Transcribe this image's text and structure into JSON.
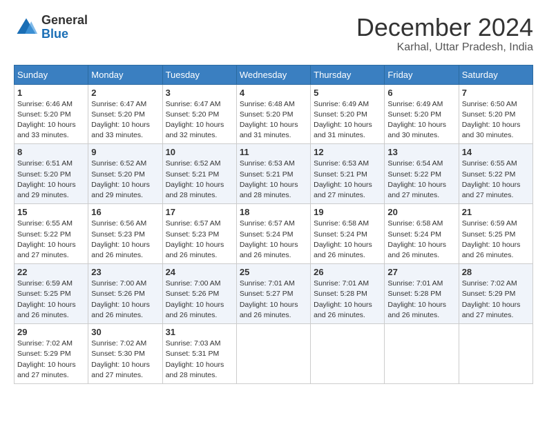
{
  "header": {
    "logo_line1": "General",
    "logo_line2": "Blue",
    "month": "December 2024",
    "location": "Karhal, Uttar Pradesh, India"
  },
  "weekdays": [
    "Sunday",
    "Monday",
    "Tuesday",
    "Wednesday",
    "Thursday",
    "Friday",
    "Saturday"
  ],
  "weeks": [
    [
      {
        "day": "1",
        "sunrise": "6:46 AM",
        "sunset": "5:20 PM",
        "daylight": "10 hours and 33 minutes."
      },
      {
        "day": "2",
        "sunrise": "6:47 AM",
        "sunset": "5:20 PM",
        "daylight": "10 hours and 33 minutes."
      },
      {
        "day": "3",
        "sunrise": "6:47 AM",
        "sunset": "5:20 PM",
        "daylight": "10 hours and 32 minutes."
      },
      {
        "day": "4",
        "sunrise": "6:48 AM",
        "sunset": "5:20 PM",
        "daylight": "10 hours and 31 minutes."
      },
      {
        "day": "5",
        "sunrise": "6:49 AM",
        "sunset": "5:20 PM",
        "daylight": "10 hours and 31 minutes."
      },
      {
        "day": "6",
        "sunrise": "6:49 AM",
        "sunset": "5:20 PM",
        "daylight": "10 hours and 30 minutes."
      },
      {
        "day": "7",
        "sunrise": "6:50 AM",
        "sunset": "5:20 PM",
        "daylight": "10 hours and 30 minutes."
      }
    ],
    [
      {
        "day": "8",
        "sunrise": "6:51 AM",
        "sunset": "5:20 PM",
        "daylight": "10 hours and 29 minutes."
      },
      {
        "day": "9",
        "sunrise": "6:52 AM",
        "sunset": "5:20 PM",
        "daylight": "10 hours and 29 minutes."
      },
      {
        "day": "10",
        "sunrise": "6:52 AM",
        "sunset": "5:21 PM",
        "daylight": "10 hours and 28 minutes."
      },
      {
        "day": "11",
        "sunrise": "6:53 AM",
        "sunset": "5:21 PM",
        "daylight": "10 hours and 28 minutes."
      },
      {
        "day": "12",
        "sunrise": "6:53 AM",
        "sunset": "5:21 PM",
        "daylight": "10 hours and 27 minutes."
      },
      {
        "day": "13",
        "sunrise": "6:54 AM",
        "sunset": "5:22 PM",
        "daylight": "10 hours and 27 minutes."
      },
      {
        "day": "14",
        "sunrise": "6:55 AM",
        "sunset": "5:22 PM",
        "daylight": "10 hours and 27 minutes."
      }
    ],
    [
      {
        "day": "15",
        "sunrise": "6:55 AM",
        "sunset": "5:22 PM",
        "daylight": "10 hours and 27 minutes."
      },
      {
        "day": "16",
        "sunrise": "6:56 AM",
        "sunset": "5:23 PM",
        "daylight": "10 hours and 26 minutes."
      },
      {
        "day": "17",
        "sunrise": "6:57 AM",
        "sunset": "5:23 PM",
        "daylight": "10 hours and 26 minutes."
      },
      {
        "day": "18",
        "sunrise": "6:57 AM",
        "sunset": "5:24 PM",
        "daylight": "10 hours and 26 minutes."
      },
      {
        "day": "19",
        "sunrise": "6:58 AM",
        "sunset": "5:24 PM",
        "daylight": "10 hours and 26 minutes."
      },
      {
        "day": "20",
        "sunrise": "6:58 AM",
        "sunset": "5:24 PM",
        "daylight": "10 hours and 26 minutes."
      },
      {
        "day": "21",
        "sunrise": "6:59 AM",
        "sunset": "5:25 PM",
        "daylight": "10 hours and 26 minutes."
      }
    ],
    [
      {
        "day": "22",
        "sunrise": "6:59 AM",
        "sunset": "5:25 PM",
        "daylight": "10 hours and 26 minutes."
      },
      {
        "day": "23",
        "sunrise": "7:00 AM",
        "sunset": "5:26 PM",
        "daylight": "10 hours and 26 minutes."
      },
      {
        "day": "24",
        "sunrise": "7:00 AM",
        "sunset": "5:26 PM",
        "daylight": "10 hours and 26 minutes."
      },
      {
        "day": "25",
        "sunrise": "7:01 AM",
        "sunset": "5:27 PM",
        "daylight": "10 hours and 26 minutes."
      },
      {
        "day": "26",
        "sunrise": "7:01 AM",
        "sunset": "5:28 PM",
        "daylight": "10 hours and 26 minutes."
      },
      {
        "day": "27",
        "sunrise": "7:01 AM",
        "sunset": "5:28 PM",
        "daylight": "10 hours and 26 minutes."
      },
      {
        "day": "28",
        "sunrise": "7:02 AM",
        "sunset": "5:29 PM",
        "daylight": "10 hours and 27 minutes."
      }
    ],
    [
      {
        "day": "29",
        "sunrise": "7:02 AM",
        "sunset": "5:29 PM",
        "daylight": "10 hours and 27 minutes."
      },
      {
        "day": "30",
        "sunrise": "7:02 AM",
        "sunset": "5:30 PM",
        "daylight": "10 hours and 27 minutes."
      },
      {
        "day": "31",
        "sunrise": "7:03 AM",
        "sunset": "5:31 PM",
        "daylight": "10 hours and 28 minutes."
      },
      null,
      null,
      null,
      null
    ]
  ]
}
